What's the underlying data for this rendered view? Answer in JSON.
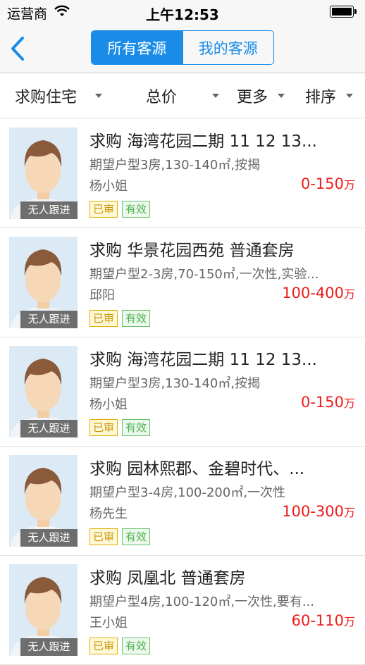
{
  "status_bar": {
    "carrier": "运营商",
    "time": "上午12:53"
  },
  "nav": {
    "back_icon": "chevron-left-icon",
    "segments": [
      {
        "label": "所有客源",
        "active": true
      },
      {
        "label": "我的客源",
        "active": false
      }
    ]
  },
  "filters": [
    {
      "label": "求购住宅"
    },
    {
      "label": "总价"
    },
    {
      "label": "更多"
    },
    {
      "label": "排序"
    }
  ],
  "colors": {
    "accent": "#1a8ce8",
    "price": "#ee1a1a"
  },
  "listings": [
    {
      "title": "求购 海湾花园二期 11 12 13...",
      "desc": "期望户型3房,130-140㎡,按揭",
      "contact": "杨小姐",
      "price": "0-150",
      "unit": "万",
      "badge": "无人跟进",
      "tags": [
        "已审",
        "有效"
      ]
    },
    {
      "title": "求购 华景花园西苑 普通套房",
      "desc": "期望户型2-3房,70-150㎡,一次性,实验...",
      "contact": "邱阳",
      "price": "100-400",
      "unit": "万",
      "badge": "无人跟进",
      "tags": [
        "已审",
        "有效"
      ]
    },
    {
      "title": "求购 海湾花园二期 11 12 13...",
      "desc": "期望户型3房,130-140㎡,按揭",
      "contact": "杨小姐",
      "price": "0-150",
      "unit": "万",
      "badge": "无人跟进",
      "tags": [
        "已审",
        "有效"
      ]
    },
    {
      "title": "求购 园林熙郡、金碧时代、...",
      "desc": "期望户型3-4房,100-200㎡,一次性",
      "contact": "杨先生",
      "price": "100-300",
      "unit": "万",
      "badge": "无人跟进",
      "tags": [
        "已审",
        "有效"
      ]
    },
    {
      "title": "求购 凤凰北 普通套房",
      "desc": "期望户型4房,100-120㎡,一次性,要有...",
      "contact": "王小姐",
      "price": "60-110",
      "unit": "万",
      "badge": "无人跟进",
      "tags": [
        "已审",
        "有效"
      ]
    }
  ]
}
